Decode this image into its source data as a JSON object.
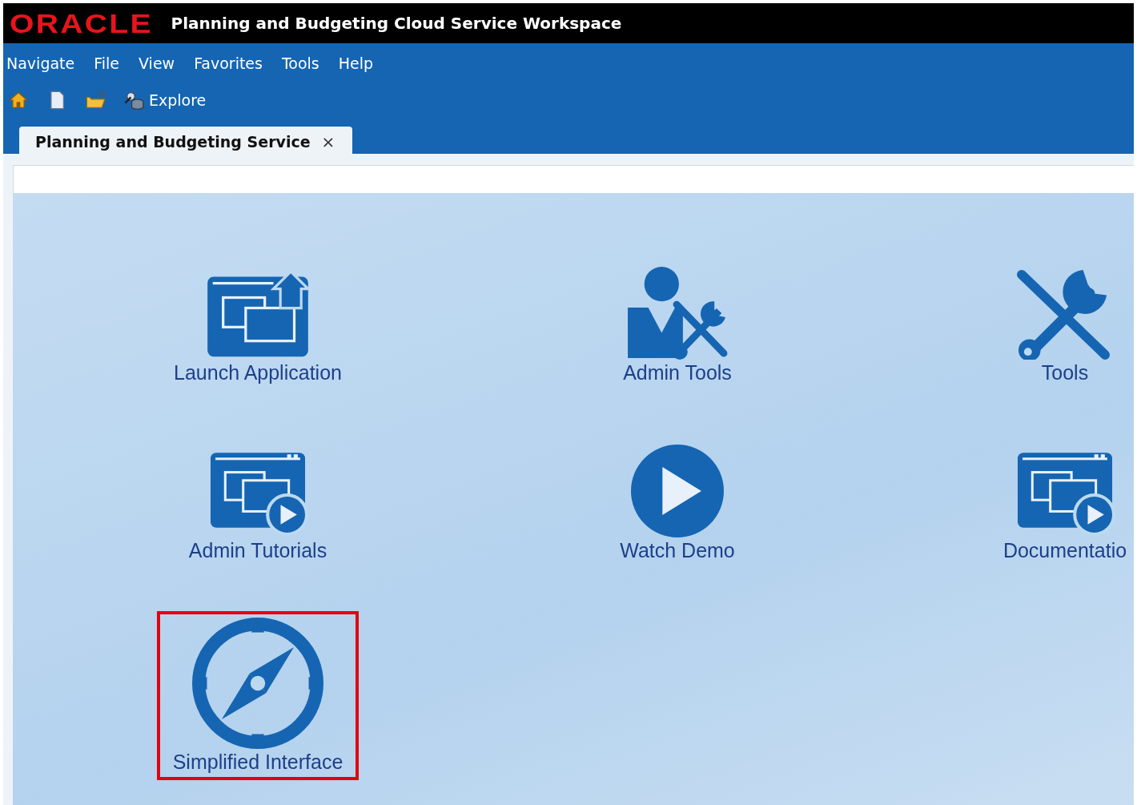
{
  "window": {
    "logo": "ORACLE",
    "title": "Planning and Budgeting Cloud Service Workspace"
  },
  "menu": [
    {
      "label": "Navigate"
    },
    {
      "label": "File"
    },
    {
      "label": "View"
    },
    {
      "label": "Favorites"
    },
    {
      "label": "Tools"
    },
    {
      "label": "Help"
    }
  ],
  "toolbar": [
    {
      "kind": "home"
    },
    {
      "kind": "new"
    },
    {
      "kind": "open"
    },
    {
      "kind": "explore",
      "label": "Explore"
    }
  ],
  "tabs": [
    {
      "label": "Planning and Budgeting Service",
      "close": "×",
      "selected": true
    }
  ],
  "tiles": [
    {
      "kind": "launch",
      "label": "Launch Application",
      "selected": false
    },
    {
      "kind": "admin-tools",
      "label": "Admin Tools",
      "selected": false
    },
    {
      "kind": "tools",
      "label": "Tools",
      "selected": false
    },
    {
      "kind": "tutorial",
      "label": "Admin Tutorials",
      "selected": false
    },
    {
      "kind": "play",
      "label": "Watch Demo",
      "selected": false
    },
    {
      "kind": "tutorial",
      "label": "Documentatio",
      "selected": false
    },
    {
      "kind": "compass",
      "label": "Simplified Interface",
      "selected": true
    }
  ]
}
